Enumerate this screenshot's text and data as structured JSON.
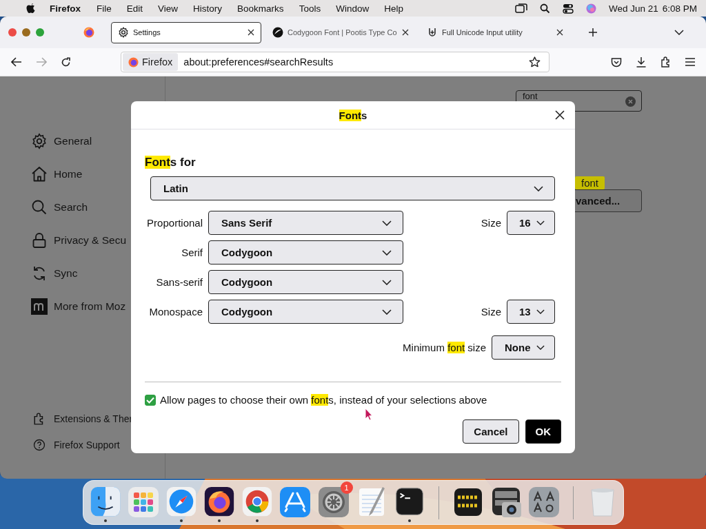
{
  "menu_bar": {
    "app": "Firefox",
    "menus": [
      "File",
      "Edit",
      "View",
      "History",
      "Bookmarks",
      "Tools",
      "Window",
      "Help"
    ],
    "date": "Wed Jun 21",
    "time": "6:08 PM"
  },
  "tabs": [
    {
      "kind": "pinned",
      "selected": false
    },
    {
      "kind": "settings",
      "label": "Settings",
      "selected": true
    },
    {
      "kind": "site",
      "label": "Codygoon Font | Pootis Type Co",
      "selected": false
    },
    {
      "kind": "unicode",
      "label": "Full Unicode Input utility",
      "selected": false
    }
  ],
  "address_bar": {
    "identity": "Firefox",
    "url": "about:preferences#searchResults"
  },
  "sidebar": {
    "items": [
      {
        "kind": "gear",
        "label": "General"
      },
      {
        "kind": "home",
        "label": "Home"
      },
      {
        "kind": "search",
        "label": "Search"
      },
      {
        "kind": "lock",
        "label": "Privacy & Secu"
      },
      {
        "kind": "sync",
        "label": "Sync"
      },
      {
        "kind": "mozilla",
        "label": "More from Moz"
      }
    ],
    "footer": [
      {
        "kind": "puzzle",
        "label": "Extensions & Ther"
      },
      {
        "kind": "help",
        "label": "Firefox Support"
      }
    ]
  },
  "search": {
    "value": "font"
  },
  "tooltip": "font",
  "advanced_button": "vanced...",
  "dialog": {
    "title": [
      {
        "text": "Font",
        "highlight": true
      },
      {
        "text": "s",
        "highlight": false
      }
    ],
    "fonts_for": {
      "label": [
        {
          "text": "Font",
          "highlight": true
        },
        {
          "text": "s for",
          "highlight": false
        }
      ],
      "value": "Latin"
    },
    "rows": [
      {
        "label": "Proportional",
        "value": "Sans Serif",
        "size_label": "Size",
        "size": "16"
      },
      {
        "label": "Serif",
        "value": "Codygoon"
      },
      {
        "label": "Sans-serif",
        "value": "Codygoon"
      },
      {
        "label": "Monospace",
        "value": "Codygoon",
        "size_label": "Size",
        "size": "13"
      }
    ],
    "minimum": {
      "label": [
        {
          "text": "Minimum ",
          "highlight": false
        },
        {
          "text": "font",
          "highlight": true
        },
        {
          "text": " size",
          "highlight": false
        }
      ],
      "value": "None"
    },
    "allow": {
      "checked": true,
      "label": [
        {
          "text": "Allow pages to choose their own ",
          "highlight": false
        },
        {
          "text": "font",
          "highlight": true
        },
        {
          "text": "s, instead of your selections above",
          "highlight": false
        }
      ]
    },
    "cancel": "Cancel",
    "ok": "OK"
  },
  "dock": {
    "apps": [
      {
        "kind": "finder",
        "running": true
      },
      {
        "kind": "launchpad",
        "running": false
      },
      {
        "kind": "safari",
        "running": true
      },
      {
        "kind": "firefox",
        "running": true
      },
      {
        "kind": "chrome",
        "running": true
      },
      {
        "kind": "appstore",
        "running": false
      },
      {
        "kind": "settings",
        "running": false,
        "badge": "1"
      },
      {
        "kind": "textedit",
        "running": false
      },
      {
        "kind": "terminal",
        "running": true
      },
      {
        "kind": "separator"
      },
      {
        "kind": "console",
        "running": false
      },
      {
        "kind": "photobooth",
        "running": false
      },
      {
        "kind": "fontbook",
        "running": false
      },
      {
        "kind": "separator"
      },
      {
        "kind": "trash",
        "running": false
      }
    ]
  }
}
